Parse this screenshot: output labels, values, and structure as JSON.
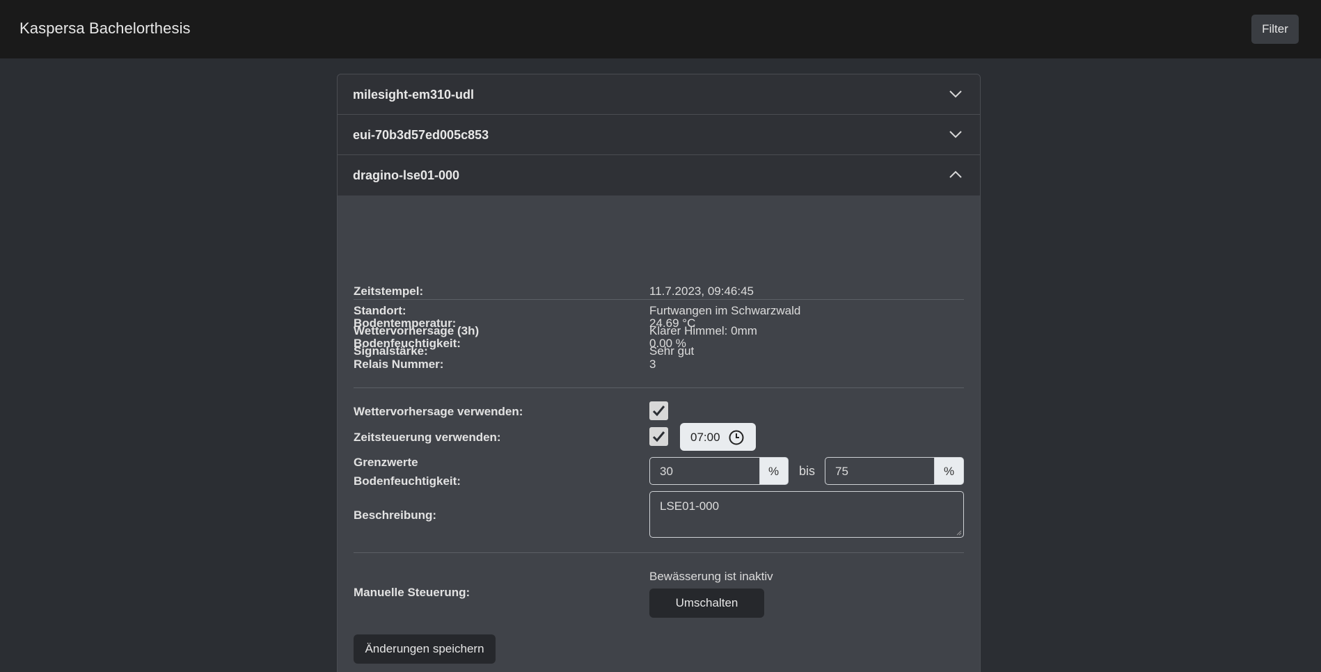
{
  "app": {
    "brand": "Kaspersa Bachelorthesis",
    "filter_label": "Filter"
  },
  "accordion": {
    "items": [
      {
        "title": "milesight-em310-udl",
        "expanded": false
      },
      {
        "title": "eui-70b3d57ed005c853",
        "expanded": false
      },
      {
        "title": "dragino-lse01-000",
        "expanded": true
      }
    ]
  },
  "details": {
    "info": [
      {
        "label": "Zeitstempel:",
        "value": "11.7.2023, 09:46:45"
      },
      {
        "label": "Standort:",
        "value": "Furtwangen im Schwarzwald"
      },
      {
        "label": "Wettervorhersage (3h)",
        "value": "Klarer Himmel: 0mm"
      },
      {
        "label": "Signalstärke:",
        "value": "Sehr gut"
      }
    ],
    "sensor": [
      {
        "label": "Bodentemperatur:",
        "value": "24.69 °C"
      },
      {
        "label": "Bodenfeuchtigkeit:",
        "value": "0.00 %"
      },
      {
        "label": "Relais Nummer:",
        "value": "3"
      }
    ]
  },
  "settings": {
    "weather_label": "Wettervorhersage verwenden:",
    "weather_checked": true,
    "schedule_label": "Zeitsteuerung verwenden:",
    "schedule_checked": true,
    "schedule_time": "07:00",
    "threshold_label_1": "Grenzwerte",
    "threshold_label_2": "Bodenfeuchtigkeit:",
    "threshold_min": "30",
    "threshold_max": "75",
    "percent_unit": "%",
    "between": "bis",
    "description_label": "Beschreibung:",
    "description_value": "LSE01-000"
  },
  "manual": {
    "label": "Manuelle Steuerung:",
    "status": "Bewässerung ist inaktiv",
    "toggle_label": "Umschalten"
  },
  "save_label": "Änderungen speichern",
  "icons": {
    "expand": "chevron-down-icon",
    "collapse": "chevron-up-icon",
    "check": "check-icon",
    "clock": "clock-icon"
  }
}
